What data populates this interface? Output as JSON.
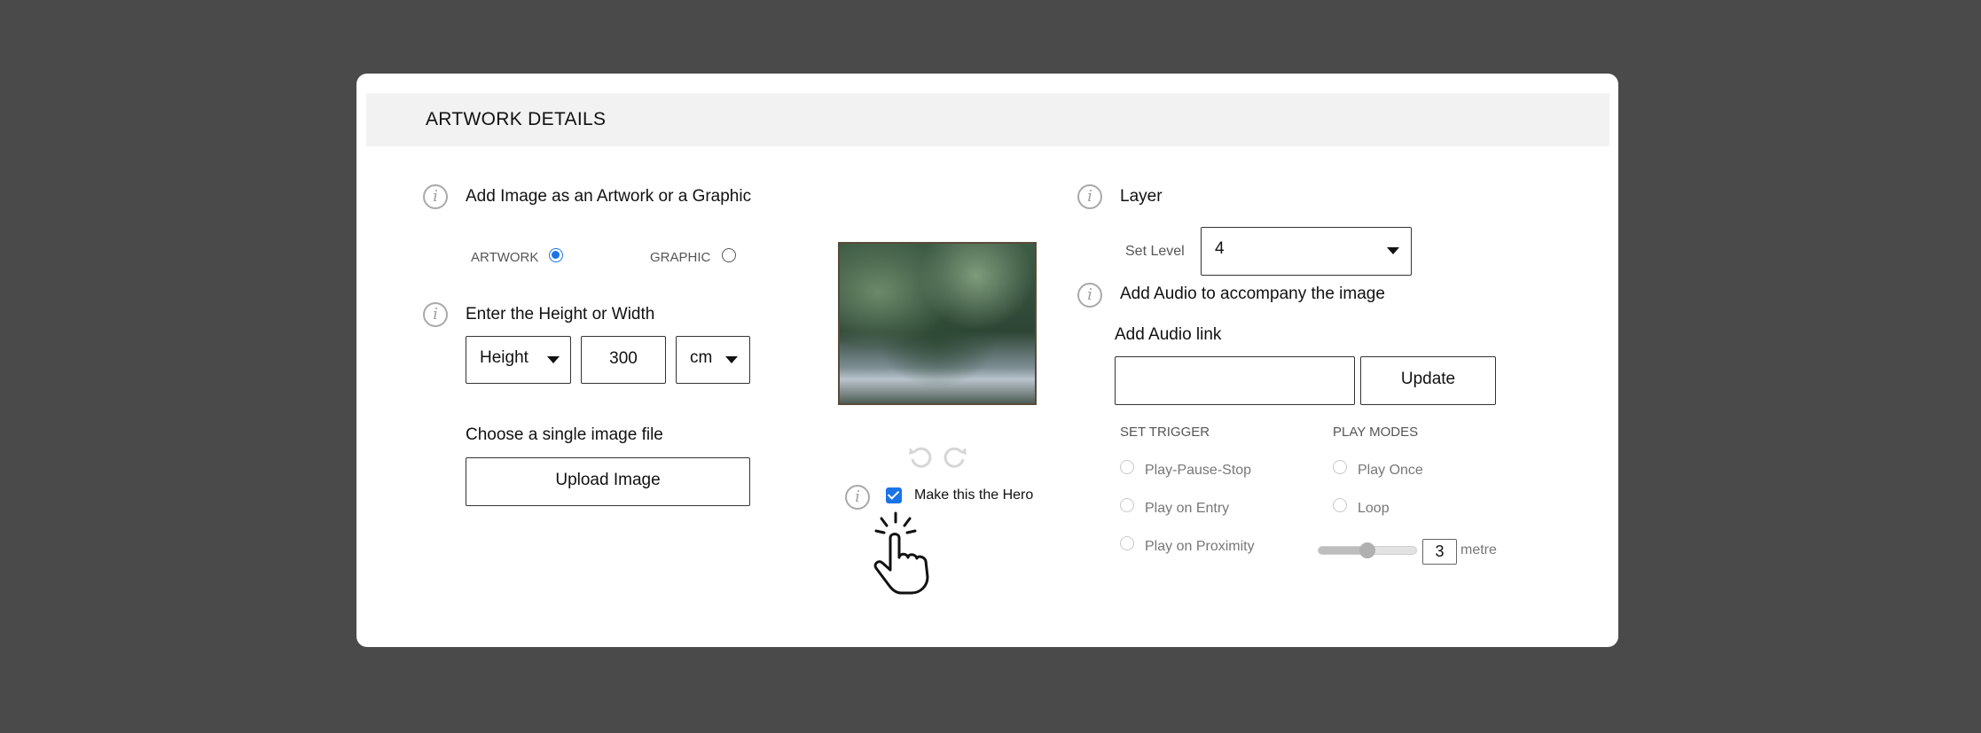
{
  "header": {
    "title": "ARTWORK DETAILS"
  },
  "left": {
    "type_heading": "Add Image as an Artwork or a Graphic",
    "type_options": [
      {
        "label": "ARTWORK",
        "checked": true
      },
      {
        "label": "GRAPHIC",
        "checked": false
      }
    ],
    "size_heading": "Enter the Height or Width",
    "dimension_select": "Height",
    "size_value": "300",
    "unit_select": "cm",
    "file_heading": "Choose a single image file",
    "upload_label": "Upload Image"
  },
  "center": {
    "hero_label": "Make this the Hero",
    "hero_checked": true,
    "icons": [
      "undo-icon",
      "redo-icon",
      "info-icon",
      "pointer-hand-icon"
    ]
  },
  "right": {
    "layer_heading": "Layer",
    "set_level_label": "Set Level",
    "level_value": "4",
    "audio_heading": "Add Audio to accompany the image",
    "audio_link_label": "Add Audio link",
    "audio_link_value": "",
    "update_label": "Update",
    "trigger_heading": "SET TRIGGER",
    "trigger_options": [
      "Play-Pause-Stop",
      "Play on Entry",
      "Play on Proximity"
    ],
    "play_modes_heading": "PLAY MODES",
    "play_mode_options": [
      "Play Once",
      "Loop"
    ],
    "proximity_value": "3",
    "proximity_unit": "metre",
    "proximity_slider_fraction": 0.5
  },
  "colors": {
    "accent": "#1a73e8",
    "background": "#4a4a4a",
    "header_bg": "#f2f2f2"
  }
}
